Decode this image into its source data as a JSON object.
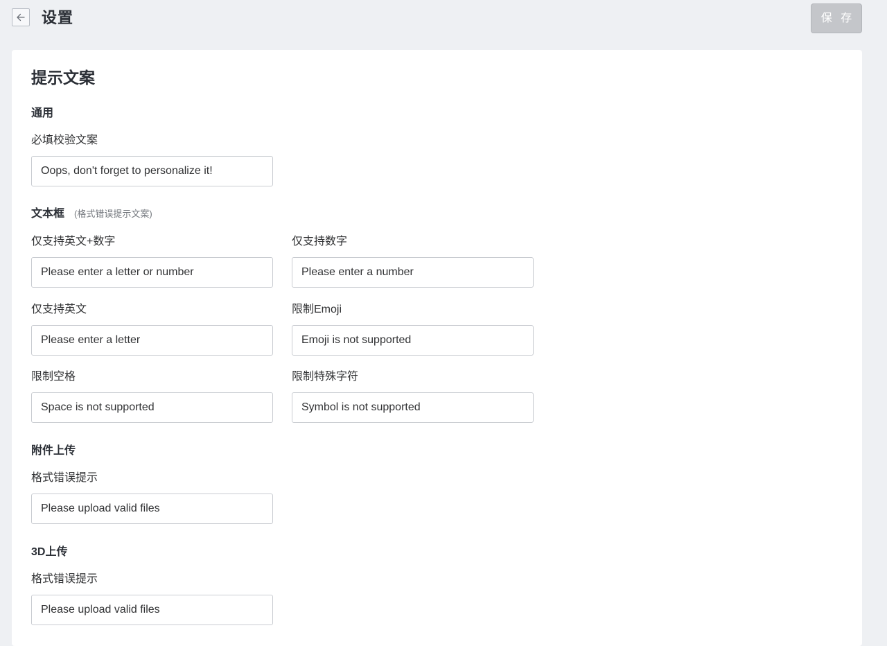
{
  "header": {
    "title": "设置",
    "save_label": "保 存",
    "back_icon": "arrow-left-icon"
  },
  "card": {
    "title": "提示文案"
  },
  "general": {
    "title": "通用",
    "required": {
      "label": "必填校验文案",
      "value": "Oops, don't forget to personalize it!"
    }
  },
  "textbox": {
    "title": "文本框",
    "note": "(格式错误提示文案)",
    "alnum": {
      "label": "仅支持英文+数字",
      "value": "Please enter a letter or number"
    },
    "number": {
      "label": "仅支持数字",
      "value": "Please enter a number"
    },
    "letter": {
      "label": "仅支持英文",
      "value": "Please enter a letter"
    },
    "emoji": {
      "label": "限制Emoji",
      "value": "Emoji is not supported"
    },
    "space": {
      "label": "限制空格",
      "value": "Space is not supported"
    },
    "symbol": {
      "label": "限制特殊字符",
      "value": "Symbol is not supported"
    }
  },
  "attachment": {
    "title": "附件上传",
    "format": {
      "label": "格式错误提示",
      "value": "Please upload valid files"
    }
  },
  "upload3d": {
    "title": "3D上传",
    "format": {
      "label": "格式错误提示",
      "value": "Please upload valid files"
    }
  }
}
